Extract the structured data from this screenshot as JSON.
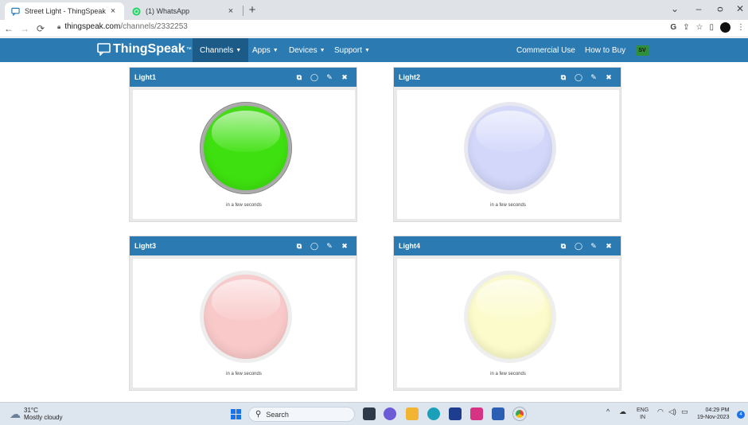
{
  "browser": {
    "tabs": [
      {
        "title": "Street Light - ThingSpeak IoT",
        "active": true
      },
      {
        "title": "(1) WhatsApp",
        "active": false
      }
    ],
    "tab_close": "×",
    "new_tab": "+",
    "window_controls": {
      "minimize": "–",
      "restore": "ᴑ",
      "close": "✕",
      "chevron": "⌄"
    },
    "url_domain": "thingspeak.com",
    "url_path": "/channels/2332253"
  },
  "navbar": {
    "logo": "ThingSpeak",
    "trademark": "™",
    "menus": [
      {
        "label": "Channels",
        "caret": true,
        "active": true
      },
      {
        "label": "Apps",
        "caret": true,
        "active": false
      },
      {
        "label": "Devices",
        "caret": true,
        "active": false
      },
      {
        "label": "Support",
        "caret": true,
        "active": false
      }
    ],
    "right_links": [
      "Commercial Use",
      "How to Buy"
    ],
    "user_badge": "SV"
  },
  "widgets": [
    {
      "title": "Light1",
      "updated": "in a few seconds",
      "state": "on",
      "color": "#3ee10f",
      "ring": "#9b9b9b"
    },
    {
      "title": "Light2",
      "updated": "in a few seconds",
      "state": "off",
      "color": "#d3d8fb",
      "ring": "#e4e4ef"
    },
    {
      "title": "Light3",
      "updated": "in a few seconds",
      "state": "off",
      "color": "#f9c9c9",
      "ring": "#ececec"
    },
    {
      "title": "Light4",
      "updated": "in a few seconds",
      "state": "off",
      "color": "#fbfbcb",
      "ring": "#ededed"
    }
  ],
  "taskbar": {
    "weather_temp": "31°C",
    "weather_desc": "Mostly cloudy",
    "search_label": "Search",
    "lang_1": "ENG",
    "lang_2": "IN",
    "time": "04:29 PM",
    "date": "19-Nov-2023",
    "notifications": "4"
  },
  "colors": {
    "brand": "#2b7bb2",
    "brand_dark": "#1c5b87"
  }
}
